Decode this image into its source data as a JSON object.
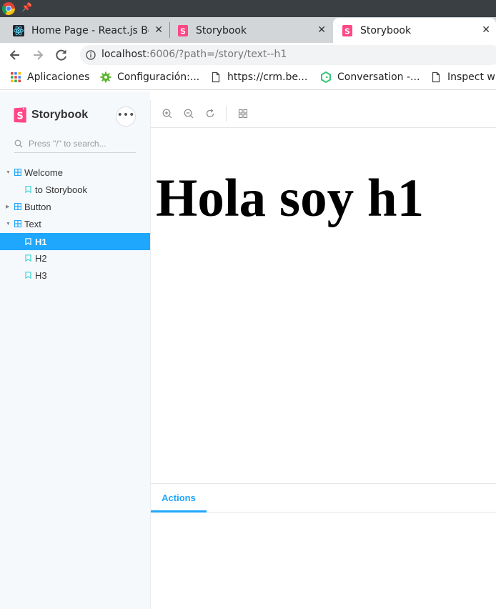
{
  "browser": {
    "tabs": [
      {
        "title": "Home Page - React.js Boilerplate",
        "icon": "react-icon"
      },
      {
        "title": "Storybook",
        "icon": "storybook-favicon"
      },
      {
        "title": "Storybook",
        "icon": "storybook-favicon",
        "active": true
      }
    ],
    "url_host": "localhost",
    "url_rest": ":6006/?path=/story/text--h1",
    "bookmarks": [
      {
        "label": "Aplicaciones",
        "icon": "apps-grid-icon"
      },
      {
        "label": "Configuración:...",
        "icon": "gear-icon"
      },
      {
        "label": "https://crm.be...",
        "icon": "page-icon"
      },
      {
        "label": "Conversation -...",
        "icon": "g-icon"
      },
      {
        "label": "Inspect wi",
        "icon": "page-icon"
      }
    ]
  },
  "sidebar": {
    "brand": "Storybook",
    "menu_label": "•••",
    "search_placeholder": "Press \"/\" to search...",
    "items": [
      {
        "label": "Welcome",
        "kind": "component",
        "expanded": true
      },
      {
        "label": "to Storybook",
        "kind": "story"
      },
      {
        "label": "Button",
        "kind": "component",
        "expanded": false
      },
      {
        "label": "Text",
        "kind": "component",
        "expanded": true
      },
      {
        "label": "H1",
        "kind": "story",
        "selected": true
      },
      {
        "label": "H2",
        "kind": "story"
      },
      {
        "label": "H3",
        "kind": "story"
      }
    ]
  },
  "canvas": {
    "heading": "Hola soy h1"
  },
  "addons": {
    "tab_label": "Actions"
  },
  "colors": {
    "accent": "#1ea7fd",
    "storybook_pink": "#ff4785",
    "sidebar_bg": "#f6f9fc"
  }
}
